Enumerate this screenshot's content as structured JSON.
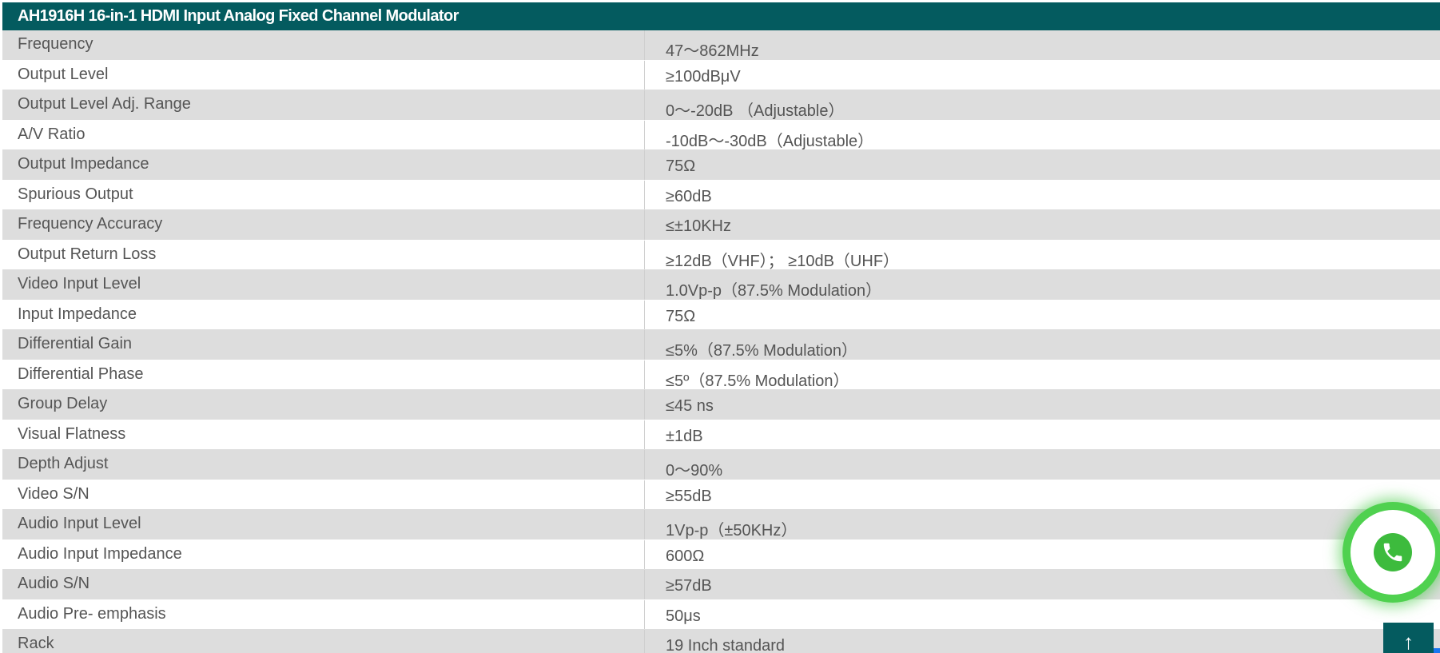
{
  "table": {
    "title": "AH1916H 16-in-1 HDMI Input Analog Fixed Channel Modulator",
    "rows": [
      {
        "label": "Frequency",
        "value": "47～862MHz"
      },
      {
        "label": "Output Level",
        "value": "≥100dBμV"
      },
      {
        "label": "Output Level Adj. Range",
        "value": "0～-20dB （Adjustable）"
      },
      {
        "label": "A/V Ratio",
        "value": "-10dB～-30dB（Adjustable）"
      },
      {
        "label": "Output Impedance",
        "value": "75Ω"
      },
      {
        "label": "Spurious Output",
        "value": "≥60dB"
      },
      {
        "label": "Frequency Accuracy",
        "value": "≤±10KHz"
      },
      {
        "label": "Output Return Loss",
        "value": "≥12dB（VHF）； ≥10dB（UHF）"
      },
      {
        "label": "Video Input Level",
        "value": "1.0Vp-p（87.5% Modulation）"
      },
      {
        "label": "Input Impedance",
        "value": "75Ω"
      },
      {
        "label": "Differential Gain",
        "value": "≤5%（87.5% Modulation）"
      },
      {
        "label": "Differential Phase",
        "value": "≤5º（87.5% Modulation）"
      },
      {
        "label": "Group Delay",
        "value": "≤45 ns"
      },
      {
        "label": "Visual Flatness",
        "value": "±1dB"
      },
      {
        "label": "Depth Adjust",
        "value": "0～90%"
      },
      {
        "label": "Video S/N",
        "value": "≥55dB"
      },
      {
        "label": "Audio Input Level",
        "value": "1Vp-p（±50KHz）"
      },
      {
        "label": "Audio Input Impedance",
        "value": "600Ω"
      },
      {
        "label": "Audio S/N",
        "value": "≥57dB"
      },
      {
        "label": "Audio Pre- emphasis",
        "value": "50μs"
      },
      {
        "label": "Rack",
        "value": "19 Inch  standard"
      }
    ]
  },
  "floating": {
    "whatsapp_icon": "whatsapp-icon",
    "scroll_top_icon": "arrow-up-icon",
    "scroll_top_glyph": "↑"
  },
  "colors": {
    "header_bg": "#045b5f",
    "row_alt_bg": "#dddddd",
    "whatsapp_green": "#3dbb3d"
  }
}
